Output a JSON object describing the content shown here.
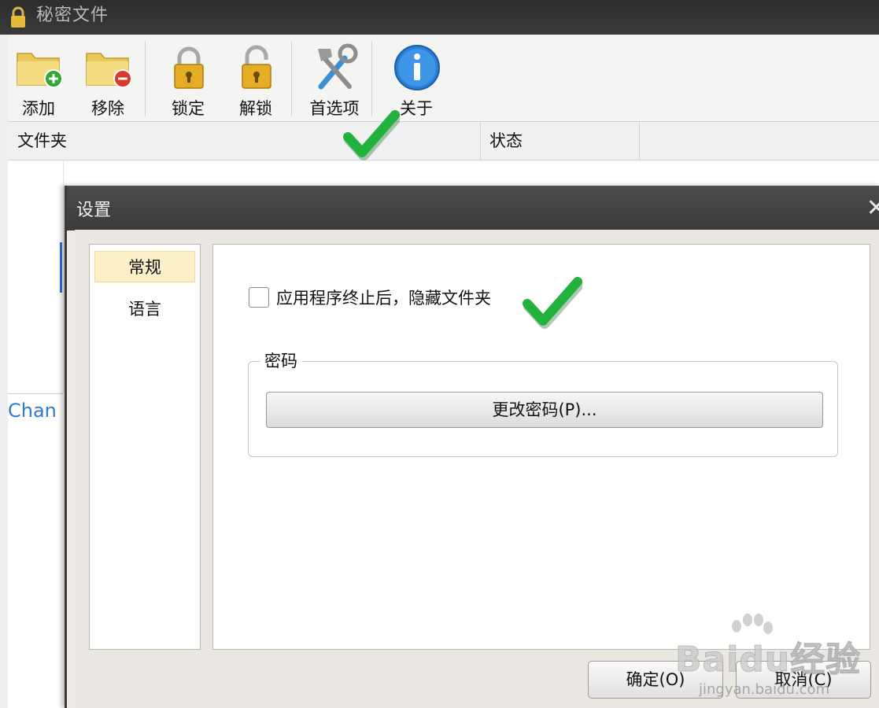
{
  "window": {
    "title": "秘密文件"
  },
  "toolbar": {
    "add": "添加",
    "remove": "移除",
    "lock": "锁定",
    "unlock": "解锁",
    "preferences": "首选项",
    "about": "关于"
  },
  "list": {
    "columns": [
      "文件夹",
      "状态"
    ],
    "link_text": "Chan"
  },
  "dialog": {
    "title": "设置",
    "close": "✕",
    "nav": [
      "常规",
      "语言"
    ],
    "selected_nav": "常规",
    "checkbox_label": "应用程序终止后，隐藏文件夹",
    "checkbox_checked": false,
    "password_group": "密码",
    "change_password": "更改密码(P)...",
    "ok": "确定(O)",
    "cancel": "取消(C)"
  },
  "watermark": {
    "brand": "Baidu经验",
    "url": "jingyan.baidu.com"
  },
  "colors": {
    "titlebar": "#3a3a3a",
    "tick_green": "#1fae3a",
    "link_blue": "#2e7bd1",
    "nav_selected": "#fdf0c8"
  }
}
